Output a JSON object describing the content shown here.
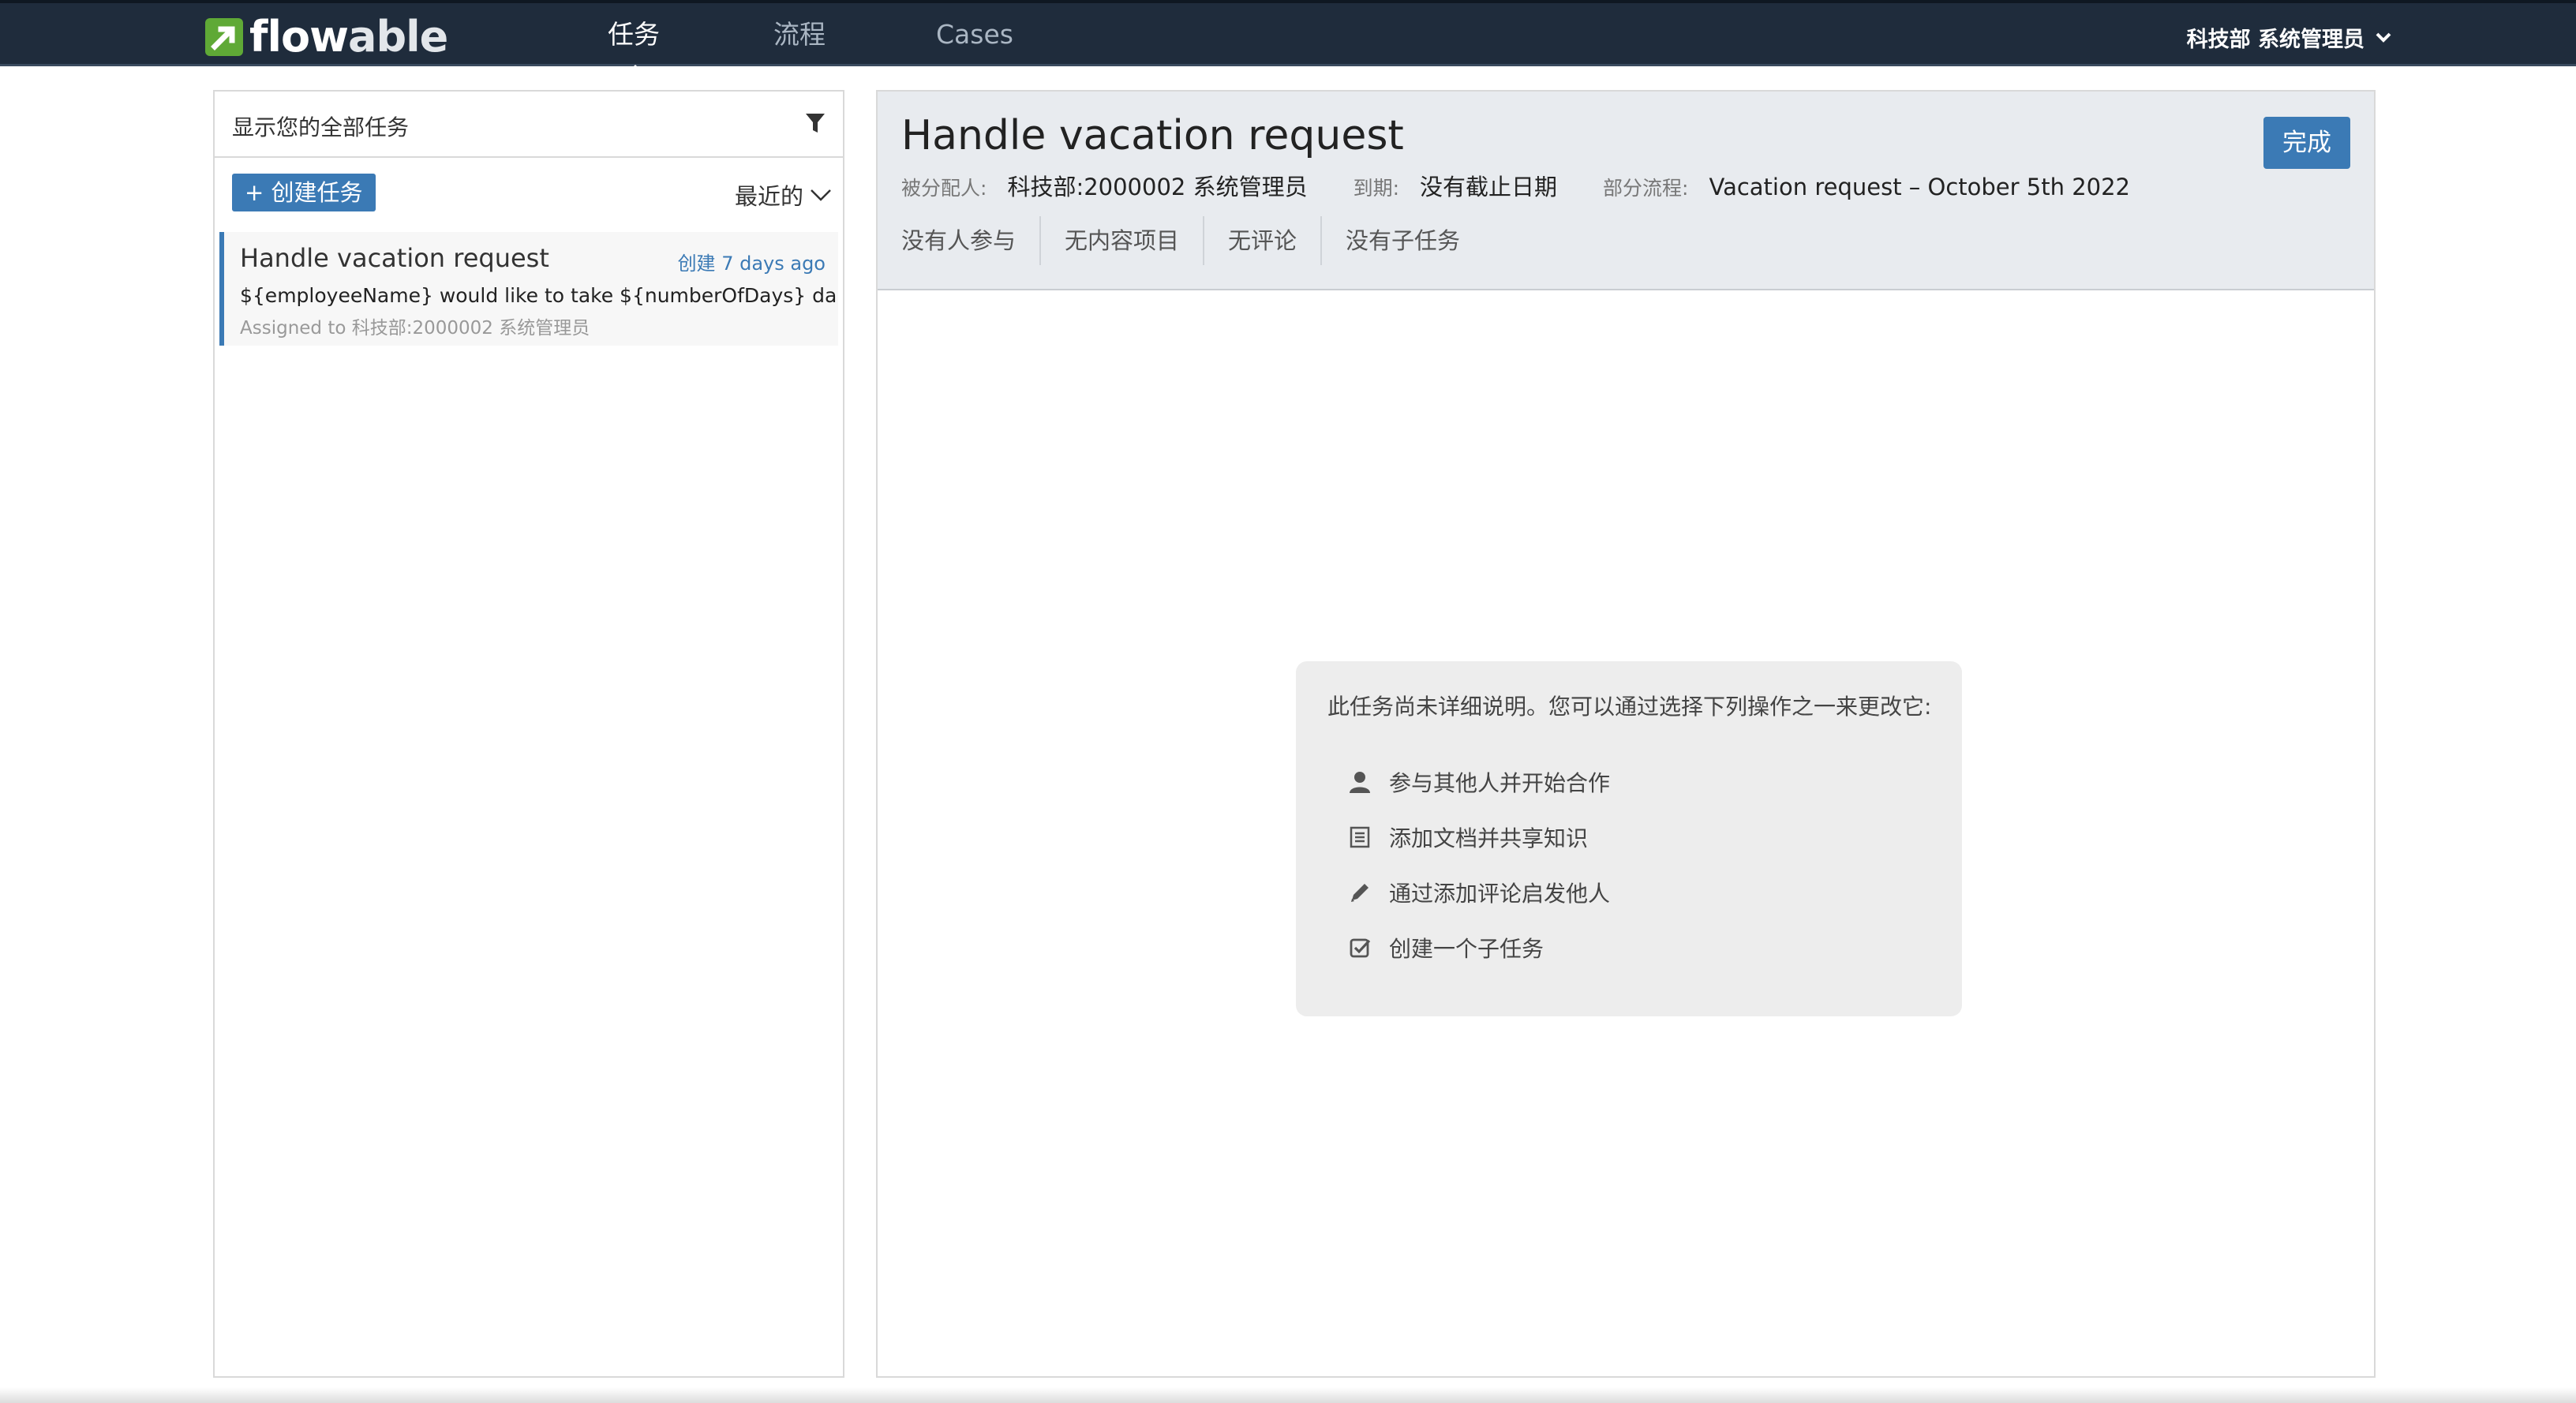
{
  "brand": {
    "logo_text_a": "flow",
    "logo_text_b": "able",
    "accent": "#5fa936"
  },
  "nav": {
    "tasks_label": "任务",
    "processes_label": "流程",
    "cases_label": "Cases",
    "active": "任务"
  },
  "user_menu": {
    "label": "科技部 系统管理员"
  },
  "task_list": {
    "filter_label": "显示您的全部任务",
    "create_label": "+ 创建任务",
    "sort_label": "最近的",
    "items": [
      {
        "title": "Handle vacation request",
        "created": "创建 7 days ago",
        "description": "${employeeName} would like to take ${numberOfDays} day(…",
        "assigned": "Assigned to 科技部:2000002 系统管理员"
      }
    ]
  },
  "detail": {
    "title": "Handle vacation request",
    "complete_label": "完成",
    "assignee_label": "被分配人:",
    "assignee_value": "科技部:2000002 系统管理员",
    "due_label": "到期:",
    "due_value": "没有截止日期",
    "process_label": "部分流程:",
    "process_value": "Vacation request – October 5th 2022",
    "tabs": [
      "没有人参与",
      "无内容项目",
      "无评论",
      "没有子任务"
    ]
  },
  "empty_state": {
    "message": "此任务尚未详细说明。您可以通过选择下列操作之一来更改它:",
    "actions": [
      {
        "icon": "user-icon",
        "label": "参与其他人并开始合作"
      },
      {
        "icon": "document-icon",
        "label": "添加文档并共享知识"
      },
      {
        "icon": "pencil-icon",
        "label": "通过添加评论启发他人"
      },
      {
        "icon": "checkbox-icon",
        "label": "创建一个子任务"
      }
    ]
  },
  "colors": {
    "navbar": "#1f2c3c",
    "primary": "#3b7ab5",
    "header_bg": "#e8ebef"
  }
}
